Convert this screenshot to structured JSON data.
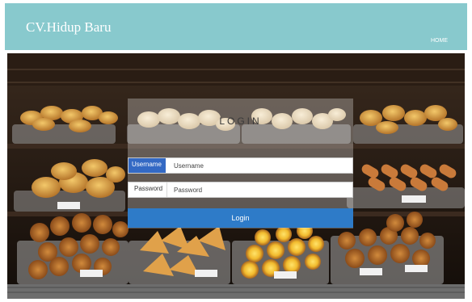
{
  "header": {
    "brand": "CV.Hidup Baru",
    "nav": {
      "home": "HOME"
    },
    "background_color": "#88c9cd"
  },
  "hero": {
    "image_description_icon": "bakery-display-image"
  },
  "login": {
    "title": "LOGIN",
    "username_label": "Username",
    "username_placeholder": "Username",
    "password_label": "Password",
    "password_placeholder": "Password",
    "button_label": "Login",
    "button_color": "#2e7bc8"
  }
}
